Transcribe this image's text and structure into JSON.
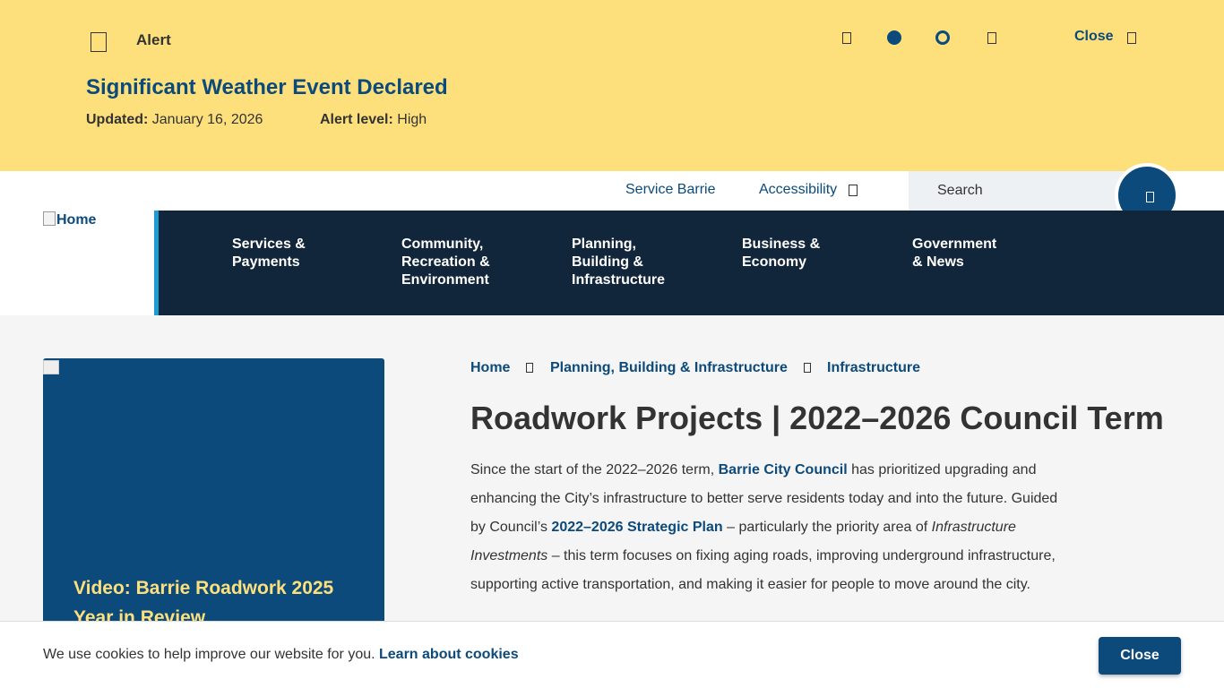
{
  "alert": {
    "tag": "Alert",
    "headline": "Significant Weather Event Declared",
    "updated_label": "Updated:",
    "updated_value": "January 16, 2026",
    "level_label": "Alert level:",
    "level_value": "High",
    "close_label": "Close",
    "controls": [
      "previous-icon",
      "slide-1-active",
      "slide-2",
      "next-icon"
    ]
  },
  "utility": {
    "service_link": "Service Barrie",
    "accessibility_link": "Accessibility",
    "search_placeholder": "Search"
  },
  "logo": {
    "alt": "Home"
  },
  "nav": {
    "items": [
      {
        "label_1": "Services &",
        "label_2": "Payments",
        "label_3": ""
      },
      {
        "label_1": "Community,",
        "label_2": "Recreation &",
        "label_3": "Environment"
      },
      {
        "label_1": "Planning,",
        "label_2": "Building &",
        "label_3": "Infrastructure"
      },
      {
        "label_1": "Business &",
        "label_2": "Economy",
        "label_3": ""
      },
      {
        "label_1": "Government",
        "label_2": "& News",
        "label_3": ""
      }
    ]
  },
  "video": {
    "caption": "Video: Barrie Roadwork 2025 Year in Review"
  },
  "breadcrumb": {
    "items": [
      "Home",
      "Planning, Building & Infrastructure",
      "Infrastructure"
    ]
  },
  "page": {
    "title": "Roadwork Projects | 2022–2026 Council Term",
    "intro_1": "Since the start of the 2022–2026 term, ",
    "intro_link_1": "Barrie City Council",
    "intro_2": " has prioritized upgrading and enhancing the City’s infrastructure to better serve residents today and into the future. Guided by Council’s ",
    "intro_link_2": "2022–2026 Strategic Plan",
    "intro_3": " – particularly the priority area of ",
    "intro_em": "Infrastructure Investments",
    "intro_4": " – this term focuses on fixing aging roads, improving underground infrastructure, supporting active transportation, and making it easier for people to move around the city."
  },
  "cookie": {
    "message": "We use cookies to help improve our website for you. ",
    "link": "Learn about cookies",
    "button": "Close"
  },
  "colors": {
    "alert_bg": "#fde07b",
    "brand_blue": "#0b4a7b",
    "nav_bg": "#12263b",
    "nav_accent": "#1f9bd3",
    "caption_yellow": "#fde07b"
  }
}
